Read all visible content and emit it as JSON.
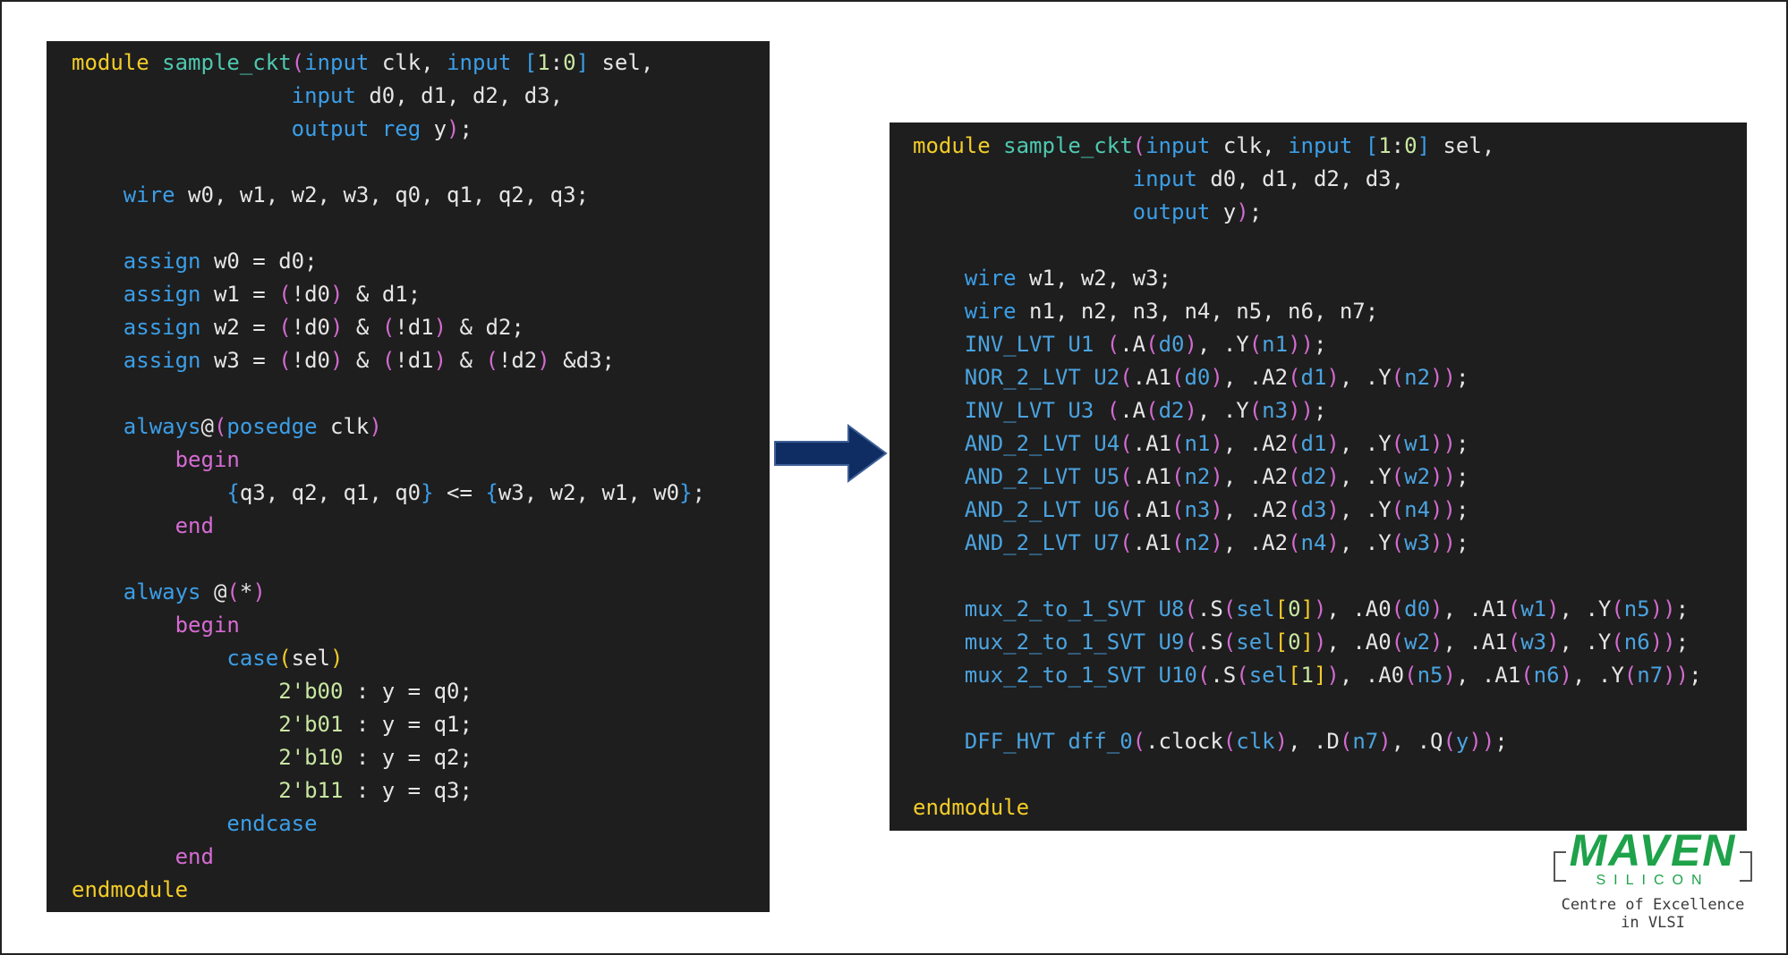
{
  "left_code": [
    [
      [
        "module ",
        "kw"
      ],
      [
        "sample_ckt",
        "mod"
      ],
      [
        "(",
        "paren"
      ],
      [
        "input ",
        "blue"
      ],
      [
        "clk, ",
        "def"
      ],
      [
        "input ",
        "blue"
      ],
      [
        "[",
        "bracket"
      ],
      [
        "1",
        "num"
      ],
      [
        ":",
        "def"
      ],
      [
        "0",
        "num"
      ],
      [
        "]",
        "bracket"
      ],
      [
        " sel,",
        "def"
      ]
    ],
    [
      [
        "                 ",
        "def"
      ],
      [
        "input ",
        "blue"
      ],
      [
        "d0, d1, d2, d3,",
        "def"
      ]
    ],
    [
      [
        "                 ",
        "def"
      ],
      [
        "output ",
        "blue"
      ],
      [
        "reg ",
        "blue"
      ],
      [
        "y",
        "def"
      ],
      [
        ")",
        "paren"
      ],
      [
        ";",
        "def"
      ]
    ],
    [],
    [
      [
        "    ",
        "def"
      ],
      [
        "wire ",
        "blue"
      ],
      [
        "w0, w1, w2, w3, q0, q1, q2, q3;",
        "def"
      ]
    ],
    [],
    [
      [
        "    ",
        "def"
      ],
      [
        "assign ",
        "blue"
      ],
      [
        "w0 = d0;",
        "def"
      ]
    ],
    [
      [
        "    ",
        "def"
      ],
      [
        "assign ",
        "blue"
      ],
      [
        "w1 = ",
        "def"
      ],
      [
        "(",
        "paren"
      ],
      [
        "!d0",
        "def"
      ],
      [
        ")",
        "paren"
      ],
      [
        " & d1;",
        "def"
      ]
    ],
    [
      [
        "    ",
        "def"
      ],
      [
        "assign ",
        "blue"
      ],
      [
        "w2 = ",
        "def"
      ],
      [
        "(",
        "paren"
      ],
      [
        "!d0",
        "def"
      ],
      [
        ")",
        "paren"
      ],
      [
        " & ",
        "def"
      ],
      [
        "(",
        "paren"
      ],
      [
        "!d1",
        "def"
      ],
      [
        ")",
        "paren"
      ],
      [
        " & d2;",
        "def"
      ]
    ],
    [
      [
        "    ",
        "def"
      ],
      [
        "assign ",
        "blue"
      ],
      [
        "w3 = ",
        "def"
      ],
      [
        "(",
        "paren"
      ],
      [
        "!d0",
        "def"
      ],
      [
        ")",
        "paren"
      ],
      [
        " & ",
        "def"
      ],
      [
        "(",
        "paren"
      ],
      [
        "!d1",
        "def"
      ],
      [
        ")",
        "paren"
      ],
      [
        " & ",
        "def"
      ],
      [
        "(",
        "paren"
      ],
      [
        "!d2",
        "def"
      ],
      [
        ")",
        "paren"
      ],
      [
        " &d3;",
        "def"
      ]
    ],
    [],
    [
      [
        "    ",
        "def"
      ],
      [
        "always",
        "blue"
      ],
      [
        "@",
        "def"
      ],
      [
        "(",
        "paren"
      ],
      [
        "posedge ",
        "blue"
      ],
      [
        "clk",
        "def"
      ],
      [
        ")",
        "paren"
      ]
    ],
    [
      [
        "        ",
        "def"
      ],
      [
        "begin",
        "pink"
      ]
    ],
    [
      [
        "            ",
        "def"
      ],
      [
        "{",
        "bracket"
      ],
      [
        "q3, q2, q1, q0",
        "def"
      ],
      [
        "}",
        "bracket"
      ],
      [
        " <= ",
        "def"
      ],
      [
        "{",
        "bracket"
      ],
      [
        "w3, w2, w1, w0",
        "def"
      ],
      [
        "}",
        "bracket"
      ],
      [
        ";",
        "def"
      ]
    ],
    [
      [
        "        ",
        "def"
      ],
      [
        "end",
        "pink"
      ]
    ],
    [],
    [
      [
        "    ",
        "def"
      ],
      [
        "always ",
        "blue"
      ],
      [
        "@",
        "def"
      ],
      [
        "(",
        "paren"
      ],
      [
        "*",
        "def"
      ],
      [
        ")",
        "paren"
      ]
    ],
    [
      [
        "        ",
        "def"
      ],
      [
        "begin",
        "pink"
      ]
    ],
    [
      [
        "            ",
        "def"
      ],
      [
        "case",
        "blue"
      ],
      [
        "(",
        "kw"
      ],
      [
        "sel",
        "def"
      ],
      [
        ")",
        "kw"
      ]
    ],
    [
      [
        "                ",
        "def"
      ],
      [
        "2'b00",
        "num"
      ],
      [
        " : y = q0;",
        "def"
      ]
    ],
    [
      [
        "                ",
        "def"
      ],
      [
        "2'b01",
        "num"
      ],
      [
        " : y = q1;",
        "def"
      ]
    ],
    [
      [
        "                ",
        "def"
      ],
      [
        "2'b10",
        "num"
      ],
      [
        " : y = q2;",
        "def"
      ]
    ],
    [
      [
        "                ",
        "def"
      ],
      [
        "2'b11",
        "num"
      ],
      [
        " : y = q3;",
        "def"
      ]
    ],
    [
      [
        "            ",
        "def"
      ],
      [
        "endcase",
        "blue"
      ]
    ],
    [
      [
        "        ",
        "def"
      ],
      [
        "end",
        "pink"
      ]
    ],
    [
      [
        "endmodule",
        "kw"
      ]
    ]
  ],
  "right_code": [
    [
      [
        "module ",
        "kw"
      ],
      [
        "sample_ckt",
        "mod"
      ],
      [
        "(",
        "paren"
      ],
      [
        "input ",
        "blue"
      ],
      [
        "clk, ",
        "def"
      ],
      [
        "input ",
        "blue"
      ],
      [
        "[",
        "bracket"
      ],
      [
        "1",
        "num"
      ],
      [
        ":",
        "def"
      ],
      [
        "0",
        "num"
      ],
      [
        "]",
        "bracket"
      ],
      [
        " sel,",
        "def"
      ]
    ],
    [
      [
        "                 ",
        "def"
      ],
      [
        "input ",
        "blue"
      ],
      [
        "d0, d1, d2, d3,",
        "def"
      ]
    ],
    [
      [
        "                 ",
        "def"
      ],
      [
        "output ",
        "blue"
      ],
      [
        "y",
        "def"
      ],
      [
        ")",
        "paren"
      ],
      [
        ";",
        "def"
      ]
    ],
    [],
    [
      [
        "    ",
        "def"
      ],
      [
        "wire ",
        "blue"
      ],
      [
        "w1, w2, w3;",
        "def"
      ]
    ],
    [
      [
        "    ",
        "def"
      ],
      [
        "wire ",
        "blue"
      ],
      [
        "n1, n2, n3, n4, n5, n6, n7;",
        "def"
      ]
    ],
    [
      [
        "    ",
        "def"
      ],
      [
        "INV_LVT U1 ",
        "cell"
      ],
      [
        "(",
        "paren"
      ],
      [
        ".A",
        "def"
      ],
      [
        "(",
        "paren"
      ],
      [
        "d0",
        "cell"
      ],
      [
        ")",
        "paren"
      ],
      [
        ", .Y",
        "def"
      ],
      [
        "(",
        "paren"
      ],
      [
        "n1",
        "cell"
      ],
      [
        "))",
        "paren"
      ],
      [
        ";",
        "def"
      ]
    ],
    [
      [
        "    ",
        "def"
      ],
      [
        "NOR_2_LVT U2",
        "cell"
      ],
      [
        "(",
        "paren"
      ],
      [
        ".A1",
        "def"
      ],
      [
        "(",
        "paren"
      ],
      [
        "d0",
        "cell"
      ],
      [
        ")",
        "paren"
      ],
      [
        ", .A2",
        "def"
      ],
      [
        "(",
        "paren"
      ],
      [
        "d1",
        "cell"
      ],
      [
        ")",
        "paren"
      ],
      [
        ", .Y",
        "def"
      ],
      [
        "(",
        "paren"
      ],
      [
        "n2",
        "cell"
      ],
      [
        "))",
        "paren"
      ],
      [
        ";",
        "def"
      ]
    ],
    [
      [
        "    ",
        "def"
      ],
      [
        "INV_LVT U3 ",
        "cell"
      ],
      [
        "(",
        "paren"
      ],
      [
        ".A",
        "def"
      ],
      [
        "(",
        "paren"
      ],
      [
        "d2",
        "cell"
      ],
      [
        ")",
        "paren"
      ],
      [
        ", .Y",
        "def"
      ],
      [
        "(",
        "paren"
      ],
      [
        "n3",
        "cell"
      ],
      [
        "))",
        "paren"
      ],
      [
        ";",
        "def"
      ]
    ],
    [
      [
        "    ",
        "def"
      ],
      [
        "AND_2_LVT U4",
        "cell"
      ],
      [
        "(",
        "paren"
      ],
      [
        ".A1",
        "def"
      ],
      [
        "(",
        "paren"
      ],
      [
        "n1",
        "cell"
      ],
      [
        ")",
        "paren"
      ],
      [
        ", .A2",
        "def"
      ],
      [
        "(",
        "paren"
      ],
      [
        "d1",
        "cell"
      ],
      [
        ")",
        "paren"
      ],
      [
        ", .Y",
        "def"
      ],
      [
        "(",
        "paren"
      ],
      [
        "w1",
        "cell"
      ],
      [
        "))",
        "paren"
      ],
      [
        ";",
        "def"
      ]
    ],
    [
      [
        "    ",
        "def"
      ],
      [
        "AND_2_LVT U5",
        "cell"
      ],
      [
        "(",
        "paren"
      ],
      [
        ".A1",
        "def"
      ],
      [
        "(",
        "paren"
      ],
      [
        "n2",
        "cell"
      ],
      [
        ")",
        "paren"
      ],
      [
        ", .A2",
        "def"
      ],
      [
        "(",
        "paren"
      ],
      [
        "d2",
        "cell"
      ],
      [
        ")",
        "paren"
      ],
      [
        ", .Y",
        "def"
      ],
      [
        "(",
        "paren"
      ],
      [
        "w2",
        "cell"
      ],
      [
        "))",
        "paren"
      ],
      [
        ";",
        "def"
      ]
    ],
    [
      [
        "    ",
        "def"
      ],
      [
        "AND_2_LVT U6",
        "cell"
      ],
      [
        "(",
        "paren"
      ],
      [
        ".A1",
        "def"
      ],
      [
        "(",
        "paren"
      ],
      [
        "n3",
        "cell"
      ],
      [
        ")",
        "paren"
      ],
      [
        ", .A2",
        "def"
      ],
      [
        "(",
        "paren"
      ],
      [
        "d3",
        "cell"
      ],
      [
        ")",
        "paren"
      ],
      [
        ", .Y",
        "def"
      ],
      [
        "(",
        "paren"
      ],
      [
        "n4",
        "cell"
      ],
      [
        "))",
        "paren"
      ],
      [
        ";",
        "def"
      ]
    ],
    [
      [
        "    ",
        "def"
      ],
      [
        "AND_2_LVT U7",
        "cell"
      ],
      [
        "(",
        "paren"
      ],
      [
        ".A1",
        "def"
      ],
      [
        "(",
        "paren"
      ],
      [
        "n2",
        "cell"
      ],
      [
        ")",
        "paren"
      ],
      [
        ", .A2",
        "def"
      ],
      [
        "(",
        "paren"
      ],
      [
        "n4",
        "cell"
      ],
      [
        ")",
        "paren"
      ],
      [
        ", .Y",
        "def"
      ],
      [
        "(",
        "paren"
      ],
      [
        "w3",
        "cell"
      ],
      [
        "))",
        "paren"
      ],
      [
        ";",
        "def"
      ]
    ],
    [],
    [
      [
        "    ",
        "def"
      ],
      [
        "mux_2_to_1_SVT U8",
        "cell"
      ],
      [
        "(",
        "paren"
      ],
      [
        ".S",
        "def"
      ],
      [
        "(",
        "paren"
      ],
      [
        "sel",
        "cell"
      ],
      [
        "[",
        "kw"
      ],
      [
        "0",
        "num"
      ],
      [
        "]",
        "kw"
      ],
      [
        ")",
        "paren"
      ],
      [
        ", .A0",
        "def"
      ],
      [
        "(",
        "paren"
      ],
      [
        "d0",
        "cell"
      ],
      [
        ")",
        "paren"
      ],
      [
        ", .A1",
        "def"
      ],
      [
        "(",
        "paren"
      ],
      [
        "w1",
        "cell"
      ],
      [
        ")",
        "paren"
      ],
      [
        ", .Y",
        "def"
      ],
      [
        "(",
        "paren"
      ],
      [
        "n5",
        "cell"
      ],
      [
        "))",
        "paren"
      ],
      [
        ";",
        "def"
      ]
    ],
    [
      [
        "    ",
        "def"
      ],
      [
        "mux_2_to_1_SVT U9",
        "cell"
      ],
      [
        "(",
        "paren"
      ],
      [
        ".S",
        "def"
      ],
      [
        "(",
        "paren"
      ],
      [
        "sel",
        "cell"
      ],
      [
        "[",
        "kw"
      ],
      [
        "0",
        "num"
      ],
      [
        "]",
        "kw"
      ],
      [
        ")",
        "paren"
      ],
      [
        ", .A0",
        "def"
      ],
      [
        "(",
        "paren"
      ],
      [
        "w2",
        "cell"
      ],
      [
        ")",
        "paren"
      ],
      [
        ", .A1",
        "def"
      ],
      [
        "(",
        "paren"
      ],
      [
        "w3",
        "cell"
      ],
      [
        ")",
        "paren"
      ],
      [
        ", .Y",
        "def"
      ],
      [
        "(",
        "paren"
      ],
      [
        "n6",
        "cell"
      ],
      [
        "))",
        "paren"
      ],
      [
        ";",
        "def"
      ]
    ],
    [
      [
        "    ",
        "def"
      ],
      [
        "mux_2_to_1_SVT U10",
        "cell"
      ],
      [
        "(",
        "paren"
      ],
      [
        ".S",
        "def"
      ],
      [
        "(",
        "paren"
      ],
      [
        "sel",
        "cell"
      ],
      [
        "[",
        "kw"
      ],
      [
        "1",
        "num"
      ],
      [
        "]",
        "kw"
      ],
      [
        ")",
        "paren"
      ],
      [
        ", .A0",
        "def"
      ],
      [
        "(",
        "paren"
      ],
      [
        "n5",
        "cell"
      ],
      [
        ")",
        "paren"
      ],
      [
        ", .A1",
        "def"
      ],
      [
        "(",
        "paren"
      ],
      [
        "n6",
        "cell"
      ],
      [
        ")",
        "paren"
      ],
      [
        ", .Y",
        "def"
      ],
      [
        "(",
        "paren"
      ],
      [
        "n7",
        "cell"
      ],
      [
        "))",
        "paren"
      ],
      [
        ";",
        "def"
      ]
    ],
    [],
    [
      [
        "    ",
        "def"
      ],
      [
        "DFF_HVT dff_0",
        "cell"
      ],
      [
        "(",
        "paren"
      ],
      [
        ".clock",
        "def"
      ],
      [
        "(",
        "paren"
      ],
      [
        "clk",
        "cell"
      ],
      [
        ")",
        "paren"
      ],
      [
        ", .D",
        "def"
      ],
      [
        "(",
        "paren"
      ],
      [
        "n7",
        "cell"
      ],
      [
        ")",
        "paren"
      ],
      [
        ", .Q",
        "def"
      ],
      [
        "(",
        "paren"
      ],
      [
        "y",
        "cell"
      ],
      [
        "))",
        "paren"
      ],
      [
        ";",
        "def"
      ]
    ],
    [],
    [
      [
        "endmodule",
        "kw"
      ]
    ]
  ],
  "logo": {
    "main": "MAVEN",
    "sub": "SILICON",
    "tagline": "Centre of Excellence in VLSI"
  },
  "colors": {
    "keyword": "#f3cc29",
    "module_name": "#4ec9b0",
    "blue_keyword": "#3b9ee8",
    "cell": "#4aa3e0",
    "paren": "#d36bd0",
    "number": "#c9e7a1",
    "begin_end": "#d66bd2",
    "text": "#e6e6e6",
    "panel_bg": "#1e1e1e",
    "arrow": "#0f2d63",
    "logo_green": "#1ea24a"
  }
}
